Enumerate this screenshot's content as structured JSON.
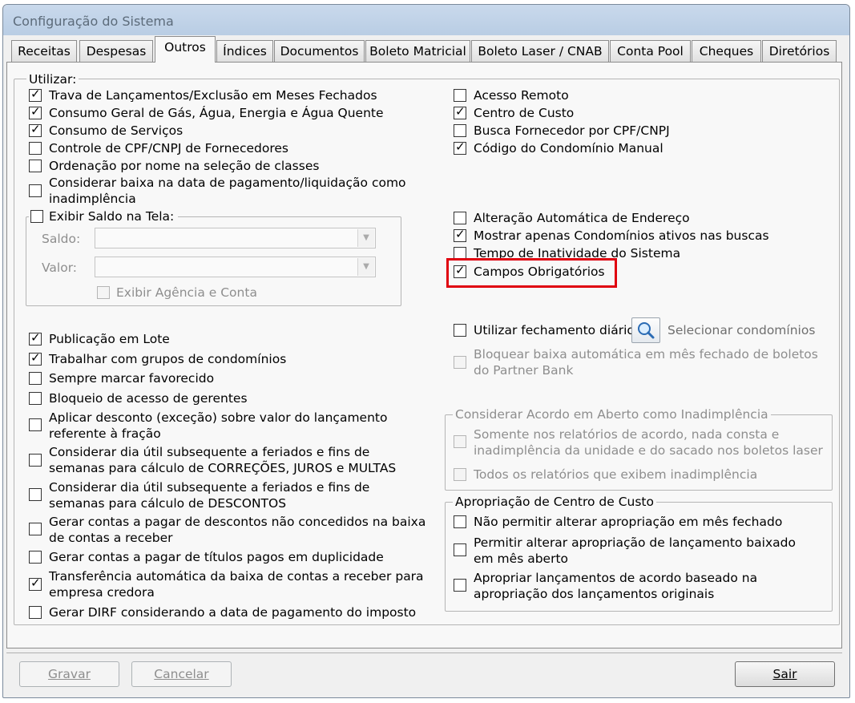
{
  "window": {
    "title": "Configuração do Sistema"
  },
  "tabs": [
    {
      "label": "Receitas"
    },
    {
      "label": "Despesas"
    },
    {
      "label": "Outros",
      "active": true
    },
    {
      "label": "Índices"
    },
    {
      "label": "Documentos"
    },
    {
      "label": "Boleto Matricial"
    },
    {
      "label": "Boleto Laser / CNAB"
    },
    {
      "label": "Conta Pool"
    },
    {
      "label": "Cheques"
    },
    {
      "label": "Diretórios"
    }
  ],
  "utilizar": {
    "title": "Utilizar:",
    "left_top": [
      {
        "label": "Trava de Lançamentos/Exclusão em Meses Fechados",
        "checked": true
      },
      {
        "label": "Consumo Geral de Gás, Água, Energia e Água Quente",
        "checked": true
      },
      {
        "label": "Consumo de Serviços",
        "checked": true
      },
      {
        "label": "Controle de CPF/CNPJ de Fornecedores",
        "checked": false
      },
      {
        "label": "Ordenação por nome na seleção de classes",
        "checked": false
      },
      {
        "label": "Considerar baixa na data de pagamento/liquidação como",
        "label2": "inadimplência",
        "checked": false
      }
    ],
    "saldo_group": {
      "title": "Exibir Saldo na Tela:",
      "checked": false,
      "saldo_label": "Saldo:",
      "valor_label": "Valor:",
      "agencia_label": "Exibir Agência e Conta"
    },
    "left_bottom": [
      {
        "label": "Publicação em Lote",
        "checked": true
      },
      {
        "label": "Trabalhar com grupos de condomínios",
        "checked": true
      },
      {
        "label": "Sempre marcar favorecido",
        "checked": false
      },
      {
        "label": "Bloqueio de acesso de gerentes",
        "checked": false
      },
      {
        "label": "Aplicar desconto (exceção) sobre valor do lançamento",
        "label2": "referente à fração",
        "checked": false
      },
      {
        "label": "Considerar dia útil subsequente a feriados e fins de",
        "label2": "semanas para cálculo de CORREÇÕES, JUROS e MULTAS",
        "checked": false
      },
      {
        "label": "Considerar dia útil subsequente a feriados e fins de",
        "label2": "semanas para cálculo de DESCONTOS",
        "checked": false
      },
      {
        "label": "Gerar contas a pagar de descontos não concedidos na baixa",
        "label2": "de contas a receber",
        "checked": false
      },
      {
        "label": "Gerar contas a pagar de títulos pagos em duplicidade",
        "checked": false
      },
      {
        "label": "Transferência automática da baixa de contas a receber para",
        "label2": "empresa credora",
        "checked": true
      },
      {
        "label": "Gerar DIRF considerando a data de pagamento do imposto",
        "checked": false
      }
    ],
    "right_top": [
      {
        "label": "Acesso Remoto",
        "checked": false
      },
      {
        "label": "Centro de Custo",
        "checked": true
      },
      {
        "label": "Busca Fornecedor por CPF/CNPJ",
        "checked": false
      },
      {
        "label": "Código do Condomínio Manual",
        "checked": true
      }
    ],
    "right_mid": [
      {
        "label": "Alteração Automática de Endereço",
        "checked": false
      },
      {
        "label": "Mostrar apenas Condomínios ativos nas buscas",
        "checked": true
      },
      {
        "label": "Tempo de Inatividade do Sistema",
        "checked": false
      },
      {
        "label": "Campos Obrigatórios",
        "checked": true
      }
    ],
    "fechamento": {
      "label": "Utilizar fechamento diário",
      "checked": false,
      "select_label": "Selecionar condomínios",
      "bloquear_label": "Bloquear baixa automática em mês fechado de boletos",
      "bloquear_label2": "do Partner Bank"
    },
    "acordo_group": {
      "title": "Considerar Acordo em Aberto como Inadimplência",
      "opt1": "Somente nos relatórios de acordo, nada consta e",
      "opt1b": "inadimplência da unidade e do sacado nos boletos laser",
      "opt2": "Todos os relatórios que exibem inadimplência"
    },
    "centro_group": {
      "title": "Apropriação de Centro de Custo",
      "items": [
        {
          "label": "Não permitir alterar apropriação em mês fechado",
          "checked": false
        },
        {
          "label": "Permitir alterar apropriação de lançamento baixado",
          "label2": "em mês aberto",
          "checked": false
        },
        {
          "label": "Apropriar lançamentos de acordo baseado na",
          "label2": "apropriação dos lançamentos originais",
          "checked": false
        }
      ]
    }
  },
  "buttons": {
    "gravar": "Gravar",
    "cancelar": "Cancelar",
    "sair": "Sair"
  },
  "colors": {
    "highlight": "#e0000f",
    "titlebar": "#c9d9ec"
  }
}
